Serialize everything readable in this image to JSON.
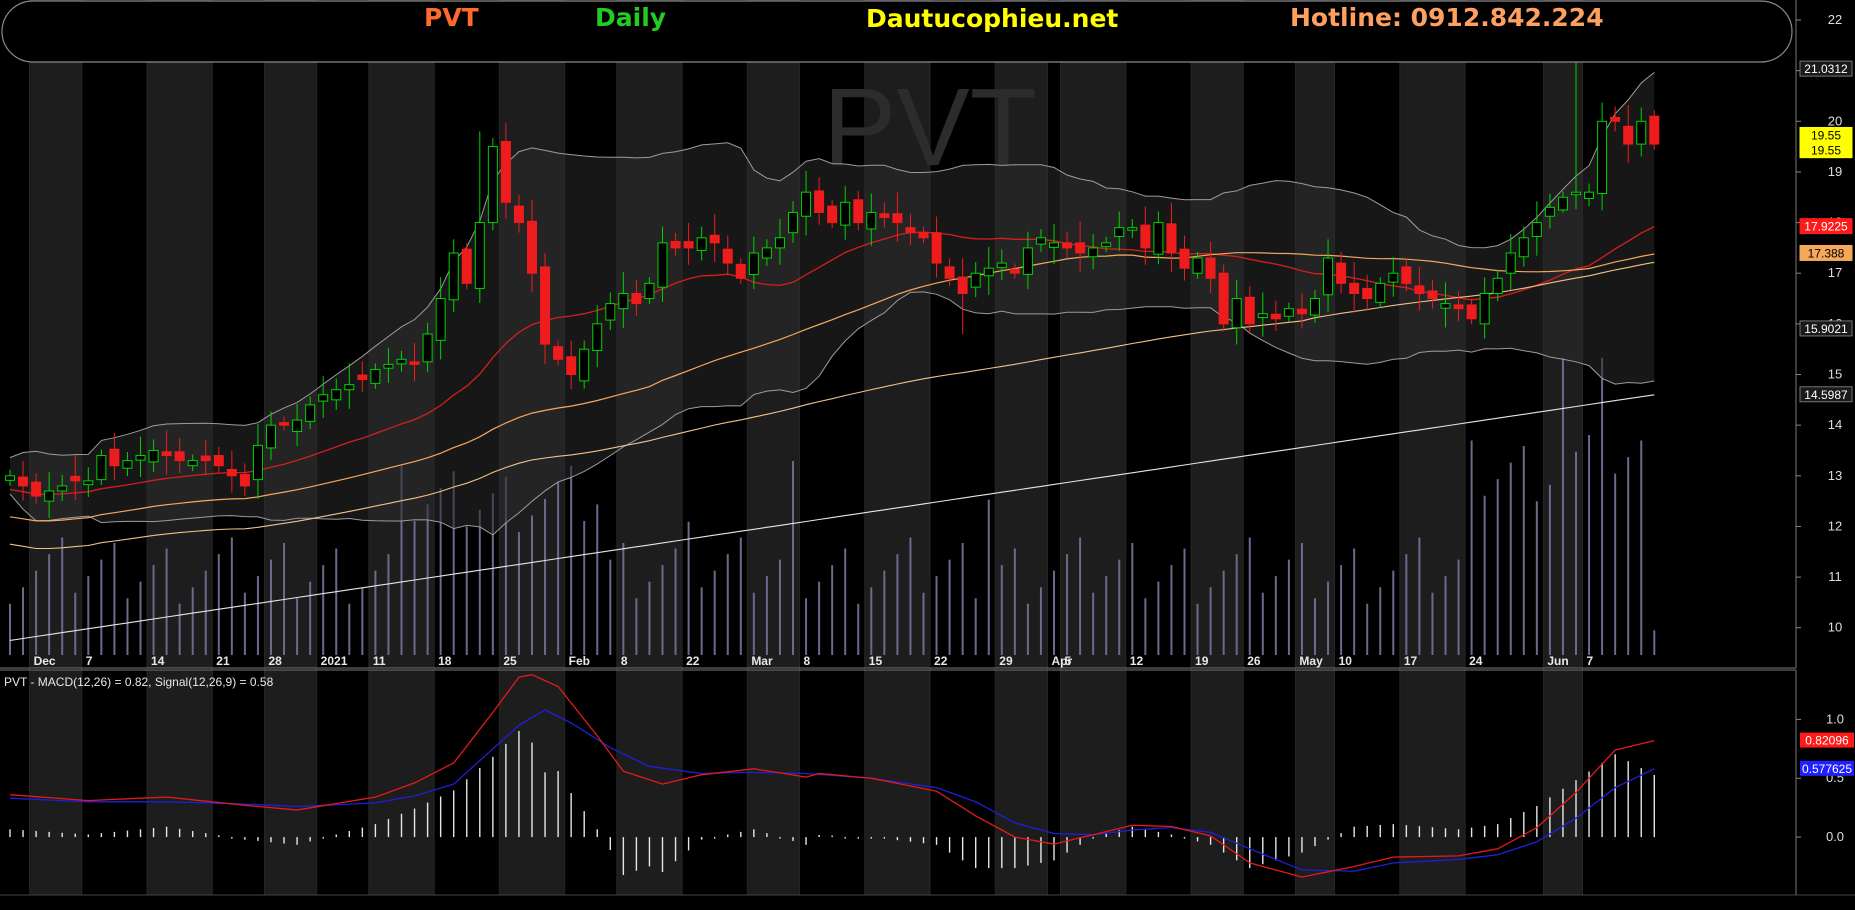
{
  "header": {
    "ticker": "PVT",
    "period": "Daily",
    "site": "Dautucophieu.net",
    "hotline": "Hotline: 0912.842.224",
    "watermark": "PVT"
  },
  "colors": {
    "background": "#000000",
    "panel_stripe": "#1d1d1d",
    "up_candle": "#00d200",
    "down_candle": "#ee1c1c",
    "ma_fast": "#d51e1e",
    "ma_mid": "#f3a860",
    "ma_slow": "#f2c18b",
    "ma_long": "#e6e6e6",
    "bollinger": "#9c9c9c",
    "volume": "#6a6a8e",
    "macd": "#e21b1b",
    "signal": "#1f1fd8",
    "ticker_color": "#ff6a2a",
    "period_color": "#22cc22",
    "site_color": "#ffff00",
    "hotline_color": "#ffa060"
  },
  "chart_data": [
    {
      "type": "candlestick",
      "panel": "price",
      "ylim": [
        9.6,
        22
      ],
      "y_ticks": [
        "10",
        "11",
        "12",
        "13",
        "14",
        "15",
        "16",
        "17",
        "18",
        "19",
        "20",
        "21",
        "22"
      ],
      "x_ticks": [
        {
          "i": 2,
          "label": "Dec"
        },
        {
          "i": 6,
          "label": "7"
        },
        {
          "i": 11,
          "label": "14"
        },
        {
          "i": 16,
          "label": "21"
        },
        {
          "i": 20,
          "label": "28"
        },
        {
          "i": 24,
          "label": "2021"
        },
        {
          "i": 28,
          "label": "11"
        },
        {
          "i": 33,
          "label": "18"
        },
        {
          "i": 38,
          "label": "25"
        },
        {
          "i": 43,
          "label": "Feb"
        },
        {
          "i": 47,
          "label": "8"
        },
        {
          "i": 52,
          "label": "22"
        },
        {
          "i": 57,
          "label": "Mar"
        },
        {
          "i": 61,
          "label": "8"
        },
        {
          "i": 66,
          "label": "15"
        },
        {
          "i": 71,
          "label": "22"
        },
        {
          "i": 76,
          "label": "29"
        },
        {
          "i": 80,
          "label": "Apr"
        },
        {
          "i": 81,
          "label": "5"
        },
        {
          "i": 86,
          "label": "12"
        },
        {
          "i": 91,
          "label": "19"
        },
        {
          "i": 95,
          "label": "26"
        },
        {
          "i": 99,
          "label": "May"
        },
        {
          "i": 102,
          "label": "10"
        },
        {
          "i": 107,
          "label": "17"
        },
        {
          "i": 112,
          "label": "24"
        },
        {
          "i": 118,
          "label": "Jun"
        },
        {
          "i": 121,
          "label": "7"
        }
      ],
      "price_tags": [
        {
          "label": "21.0312",
          "value": 21.03,
          "bg": "#1a1a1a",
          "fg": "#ffffff",
          "border": "#777777"
        },
        {
          "label": "19.55",
          "value": 19.72,
          "bg": "#ffff00",
          "fg": "#000000",
          "border": "#ffff00"
        },
        {
          "label": "19.55",
          "value": 19.42,
          "bg": "#ffff00",
          "fg": "#000000",
          "border": "#ffff00"
        },
        {
          "label": "17.9225",
          "value": 17.92,
          "bg": "#ff1a1a",
          "fg": "#ffffff",
          "border": "#ff1a1a"
        },
        {
          "label": "17.388",
          "value": 17.39,
          "bg": "#f5a85a",
          "fg": "#000000",
          "border": "#f5a85a"
        },
        {
          "label": "15.9021",
          "value": 15.9,
          "bg": "#1a1a1a",
          "fg": "#ffffff",
          "border": "#777777"
        },
        {
          "label": "14.5987",
          "value": 14.6,
          "bg": "#1a1a1a",
          "fg": "#ffffff",
          "border": "#777777"
        }
      ],
      "closes": [
        13.0,
        12.8,
        12.6,
        12.7,
        12.8,
        12.9,
        12.9,
        13.4,
        13.2,
        13.3,
        13.4,
        13.5,
        13.4,
        13.3,
        13.3,
        13.3,
        13.2,
        13.0,
        12.8,
        13.6,
        14.0,
        14.0,
        14.1,
        14.4,
        14.6,
        14.7,
        14.8,
        14.9,
        15.1,
        15.2,
        15.3,
        15.2,
        15.8,
        16.5,
        17.4,
        16.8,
        18.0,
        19.5,
        18.4,
        18.0,
        17.0,
        15.6,
        15.3,
        15.0,
        15.5,
        16.0,
        16.4,
        16.6,
        16.4,
        16.8,
        17.6,
        17.5,
        17.5,
        17.7,
        17.6,
        17.2,
        16.9,
        17.4,
        17.5,
        17.7,
        18.2,
        18.6,
        18.2,
        18.0,
        18.4,
        18.0,
        18.2,
        18.1,
        18.0,
        17.8,
        17.7,
        17.2,
        16.9,
        16.6,
        17.0,
        17.1,
        17.2,
        17.0,
        17.5,
        17.7,
        17.6,
        17.5,
        17.4,
        17.5,
        17.6,
        17.9,
        17.9,
        17.5,
        18.0,
        17.4,
        17.1,
        17.3,
        16.9,
        16.0,
        16.5,
        16.0,
        16.2,
        16.1,
        16.3,
        16.2,
        16.5,
        17.3,
        16.8,
        16.6,
        16.5,
        16.8,
        17.0,
        16.8,
        16.6,
        16.5,
        16.4,
        16.3,
        16.1,
        16.6,
        16.9,
        17.4,
        17.7,
        18.0,
        18.3,
        18.5,
        18.6,
        18.6,
        20.0,
        20.0,
        19.55,
        20.0,
        19.55
      ]
    },
    {
      "type": "line",
      "panel": "macd",
      "title": "PVT - MACD(12,26) = 0.82, Signal(12,26,9) = 0.58",
      "series": [
        {
          "name": "MACD(12,26)",
          "last": 0.82,
          "tag": "0.82096"
        },
        {
          "name": "Signal(12,26,9)",
          "last": 0.58,
          "tag": "0.577625"
        }
      ],
      "y_ticks": [
        "0.0",
        "0.5",
        "1.0"
      ],
      "ylim": [
        -0.45,
        1.25
      ],
      "macd_knots": [
        [
          0,
          0.36
        ],
        [
          6,
          0.31
        ],
        [
          12,
          0.34
        ],
        [
          18,
          0.27
        ],
        [
          22,
          0.23
        ],
        [
          28,
          0.34
        ],
        [
          31,
          0.46
        ],
        [
          34,
          0.63
        ],
        [
          37,
          1.06
        ],
        [
          39,
          1.36
        ],
        [
          40,
          1.38
        ],
        [
          42,
          1.28
        ],
        [
          45,
          0.86
        ],
        [
          47,
          0.56
        ],
        [
          50,
          0.45
        ],
        [
          53,
          0.53
        ],
        [
          57,
          0.58
        ],
        [
          61,
          0.51
        ],
        [
          62,
          0.54
        ],
        [
          66,
          0.5
        ],
        [
          71,
          0.39
        ],
        [
          74,
          0.18
        ],
        [
          77,
          0.0
        ],
        [
          80,
          -0.06
        ],
        [
          83,
          0.02
        ],
        [
          86,
          0.1
        ],
        [
          89,
          0.09
        ],
        [
          92,
          0.01
        ],
        [
          95,
          -0.22
        ],
        [
          99,
          -0.34
        ],
        [
          103,
          -0.25
        ],
        [
          106,
          -0.17
        ],
        [
          111,
          -0.16
        ],
        [
          114,
          -0.1
        ],
        [
          117,
          0.08
        ],
        [
          120,
          0.38
        ],
        [
          123,
          0.74
        ],
        [
          126,
          0.82
        ]
      ],
      "signal_knots": [
        [
          0,
          0.33
        ],
        [
          6,
          0.3
        ],
        [
          12,
          0.3
        ],
        [
          18,
          0.28
        ],
        [
          22,
          0.26
        ],
        [
          28,
          0.29
        ],
        [
          31,
          0.35
        ],
        [
          34,
          0.45
        ],
        [
          37,
          0.75
        ],
        [
          39,
          0.95
        ],
        [
          41,
          1.08
        ],
        [
          43,
          0.97
        ],
        [
          46,
          0.76
        ],
        [
          49,
          0.6
        ],
        [
          53,
          0.54
        ],
        [
          57,
          0.55
        ],
        [
          61,
          0.54
        ],
        [
          66,
          0.5
        ],
        [
          71,
          0.42
        ],
        [
          74,
          0.3
        ],
        [
          77,
          0.12
        ],
        [
          80,
          0.03
        ],
        [
          83,
          0.02
        ],
        [
          86,
          0.06
        ],
        [
          89,
          0.08
        ],
        [
          92,
          0.04
        ],
        [
          95,
          -0.1
        ],
        [
          99,
          -0.28
        ],
        [
          103,
          -0.29
        ],
        [
          106,
          -0.22
        ],
        [
          111,
          -0.19
        ],
        [
          114,
          -0.15
        ],
        [
          117,
          -0.04
        ],
        [
          120,
          0.16
        ],
        [
          123,
          0.42
        ],
        [
          126,
          0.58
        ]
      ],
      "hist_scale": 2.2
    }
  ]
}
